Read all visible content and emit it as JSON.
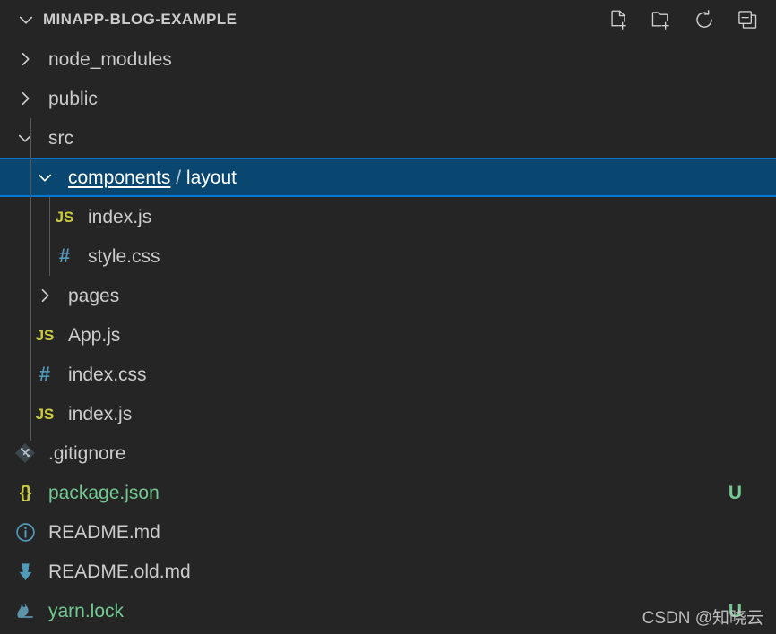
{
  "theme": {
    "background": "#252526",
    "foreground": "#cccccc",
    "selection_background": "#094771",
    "selection_border": "#0078d4",
    "untracked_green": "#73c991",
    "js_yellow": "#cbcb41",
    "css_blue": "#519aba"
  },
  "header": {
    "title": "MINAPP-BLOG-EXAMPLE",
    "twisty": "chevron-down-icon",
    "actions": [
      {
        "name": "new-file",
        "tooltip": "New File"
      },
      {
        "name": "new-folder",
        "tooltip": "New Folder"
      },
      {
        "name": "refresh",
        "tooltip": "Refresh Explorer"
      },
      {
        "name": "collapse-all",
        "tooltip": "Collapse Folders in Explorer"
      }
    ]
  },
  "tree": {
    "rows": [
      {
        "id": "node_modules",
        "label": "node_modules",
        "kind": "folder",
        "twisty": "chevron-right-icon",
        "expanded": false,
        "depth": 1,
        "selected": false,
        "badge": ""
      },
      {
        "id": "public",
        "label": "public",
        "kind": "folder",
        "twisty": "chevron-right-icon",
        "expanded": false,
        "depth": 1,
        "selected": false,
        "badge": ""
      },
      {
        "id": "src",
        "label": "src",
        "kind": "folder",
        "twisty": "chevron-down-icon",
        "expanded": true,
        "depth": 1,
        "selected": false,
        "badge": ""
      },
      {
        "id": "components-layout",
        "label": "components / layout",
        "label_parts": {
          "first": "components",
          "separator": "/",
          "second": "layout"
        },
        "kind": "folder",
        "twisty": "chevron-down-icon",
        "expanded": true,
        "depth": 2,
        "selected": true,
        "badge": ""
      },
      {
        "id": "layout-index-js",
        "label": "index.js",
        "kind": "file",
        "icon": "js-file-icon",
        "glyph": "JS",
        "depth": 3,
        "selected": false,
        "badge": ""
      },
      {
        "id": "layout-style-css",
        "label": "style.css",
        "kind": "file",
        "icon": "css-file-icon",
        "glyph": "#",
        "depth": 3,
        "selected": false,
        "badge": ""
      },
      {
        "id": "pages",
        "label": "pages",
        "kind": "folder",
        "twisty": "chevron-right-icon",
        "expanded": false,
        "depth": 2,
        "selected": false,
        "badge": ""
      },
      {
        "id": "app-js",
        "label": "App.js",
        "kind": "file",
        "icon": "js-file-icon",
        "glyph": "JS",
        "depth": 2,
        "selected": false,
        "badge": ""
      },
      {
        "id": "src-index-css",
        "label": "index.css",
        "kind": "file",
        "icon": "css-file-icon",
        "glyph": "#",
        "depth": 2,
        "selected": false,
        "badge": ""
      },
      {
        "id": "src-index-js",
        "label": "index.js",
        "kind": "file",
        "icon": "js-file-icon",
        "glyph": "JS",
        "depth": 2,
        "selected": false,
        "badge": ""
      },
      {
        "id": "gitignore",
        "label": ".gitignore",
        "kind": "file",
        "icon": "git-file-icon",
        "depth": 1,
        "selected": false,
        "badge": ""
      },
      {
        "id": "package-json",
        "label": "package.json",
        "kind": "file",
        "icon": "json-file-icon",
        "glyph": "{}",
        "depth": 1,
        "selected": false,
        "status": "untracked",
        "badge": "U"
      },
      {
        "id": "readme-md",
        "label": "README.md",
        "kind": "file",
        "icon": "markdown-info-icon",
        "depth": 1,
        "selected": false,
        "badge": ""
      },
      {
        "id": "readme-old-md",
        "label": "README.old.md",
        "kind": "file",
        "icon": "download-arrow-icon",
        "depth": 1,
        "selected": false,
        "badge": ""
      },
      {
        "id": "yarn-lock",
        "label": "yarn.lock",
        "kind": "file",
        "icon": "yarn-cat-icon",
        "depth": 1,
        "selected": false,
        "status": "untracked",
        "badge": "U"
      }
    ]
  },
  "watermark": {
    "text": "CSDN @知晓云"
  }
}
